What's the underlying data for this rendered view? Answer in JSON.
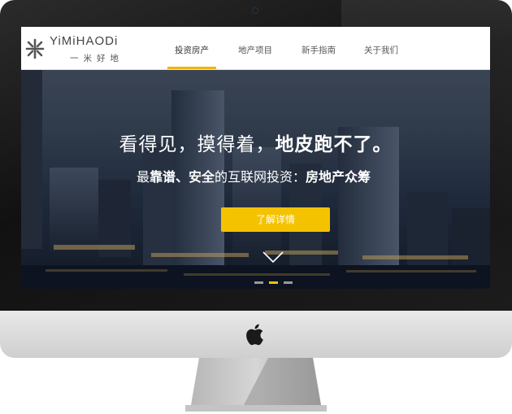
{
  "site": {
    "logo_en": "YiMiHAODi",
    "logo_cn": "一米好地",
    "nav": [
      {
        "label": "投资房产",
        "active": true
      },
      {
        "label": "地产项目",
        "active": false
      },
      {
        "label": "新手指南",
        "active": false
      },
      {
        "label": "关于我们",
        "active": false
      }
    ]
  },
  "hero": {
    "headline_part1": "看得见，摸得着，",
    "headline_part2": "地皮跑不了。",
    "sub_prefix": "最",
    "sub_bold1": "靠谱、安全",
    "sub_mid": "的互联网投资：",
    "sub_bold2": "房地产众筹",
    "cta_label": "了解详情",
    "carousel_total": 3,
    "carousel_active": 2
  },
  "colors": {
    "accent": "#f5c200",
    "nav_underline": "#f0b400",
    "bezel": "#1a1a1a",
    "chin": "#dcdcdc"
  },
  "icons": [
    "apple-icon",
    "camera-icon",
    "logo-mark-icon",
    "chevron-down-icon"
  ]
}
